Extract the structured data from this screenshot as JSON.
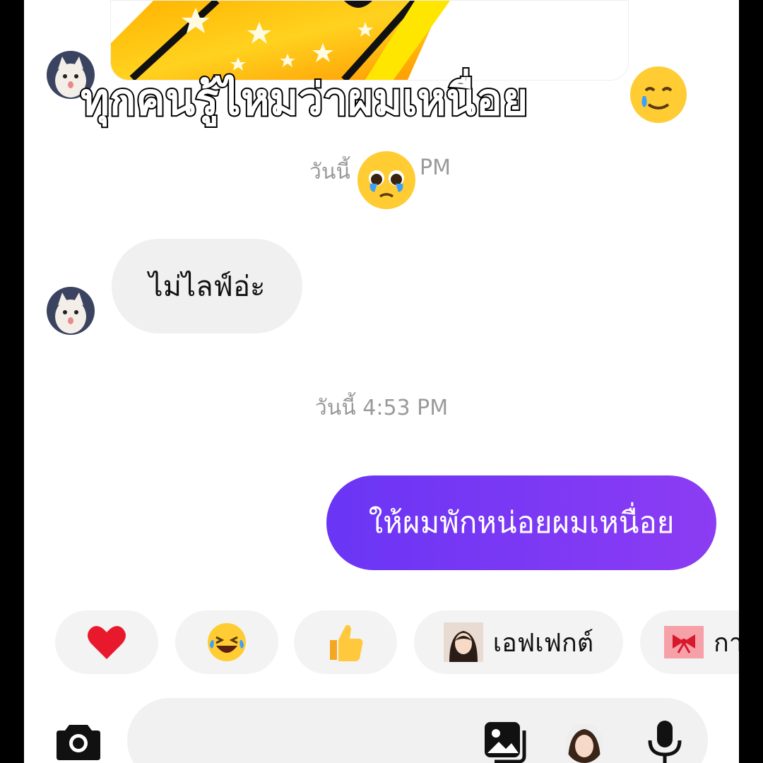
{
  "overlay": {
    "caption": "ทุกคนรู้ไหมว่าผมเหนื่อย",
    "caption_emoji_icon": "smiling-face-with-tear-icon",
    "timestamp_emoji_icon": "pleading-face-icon"
  },
  "messages": {
    "timestamp_1_prefix": "วันนี้",
    "timestamp_1_suffix": "PM",
    "incoming_text": "ไม่ไลฟ์อ่ะ",
    "timestamp_2": "วันนี้ 4:53 PM",
    "outgoing_text": "ให้ผมพักหน่อยผมเหนื่อย"
  },
  "reactions": [
    {
      "icon": "heart-icon",
      "label": ""
    },
    {
      "icon": "laughing-tears-icon",
      "label": ""
    },
    {
      "icon": "thumbs-up-icon",
      "label": ""
    },
    {
      "icon": "effect-avatar-icon",
      "label": "เอฟเฟกต์"
    },
    {
      "icon": "gift-icon",
      "label": "กา"
    }
  ],
  "composer": {
    "camera_icon": "camera-icon",
    "gallery_icon": "gallery-icon",
    "avatar_icon": "avatar-icon",
    "mic_icon": "microphone-icon"
  },
  "colors": {
    "outgoing_bubble_start": "#6a35f5",
    "outgoing_bubble_end": "#8c3cf3",
    "incoming_bubble": "#f0f0f0",
    "timestamp": "#9a9a9a"
  }
}
